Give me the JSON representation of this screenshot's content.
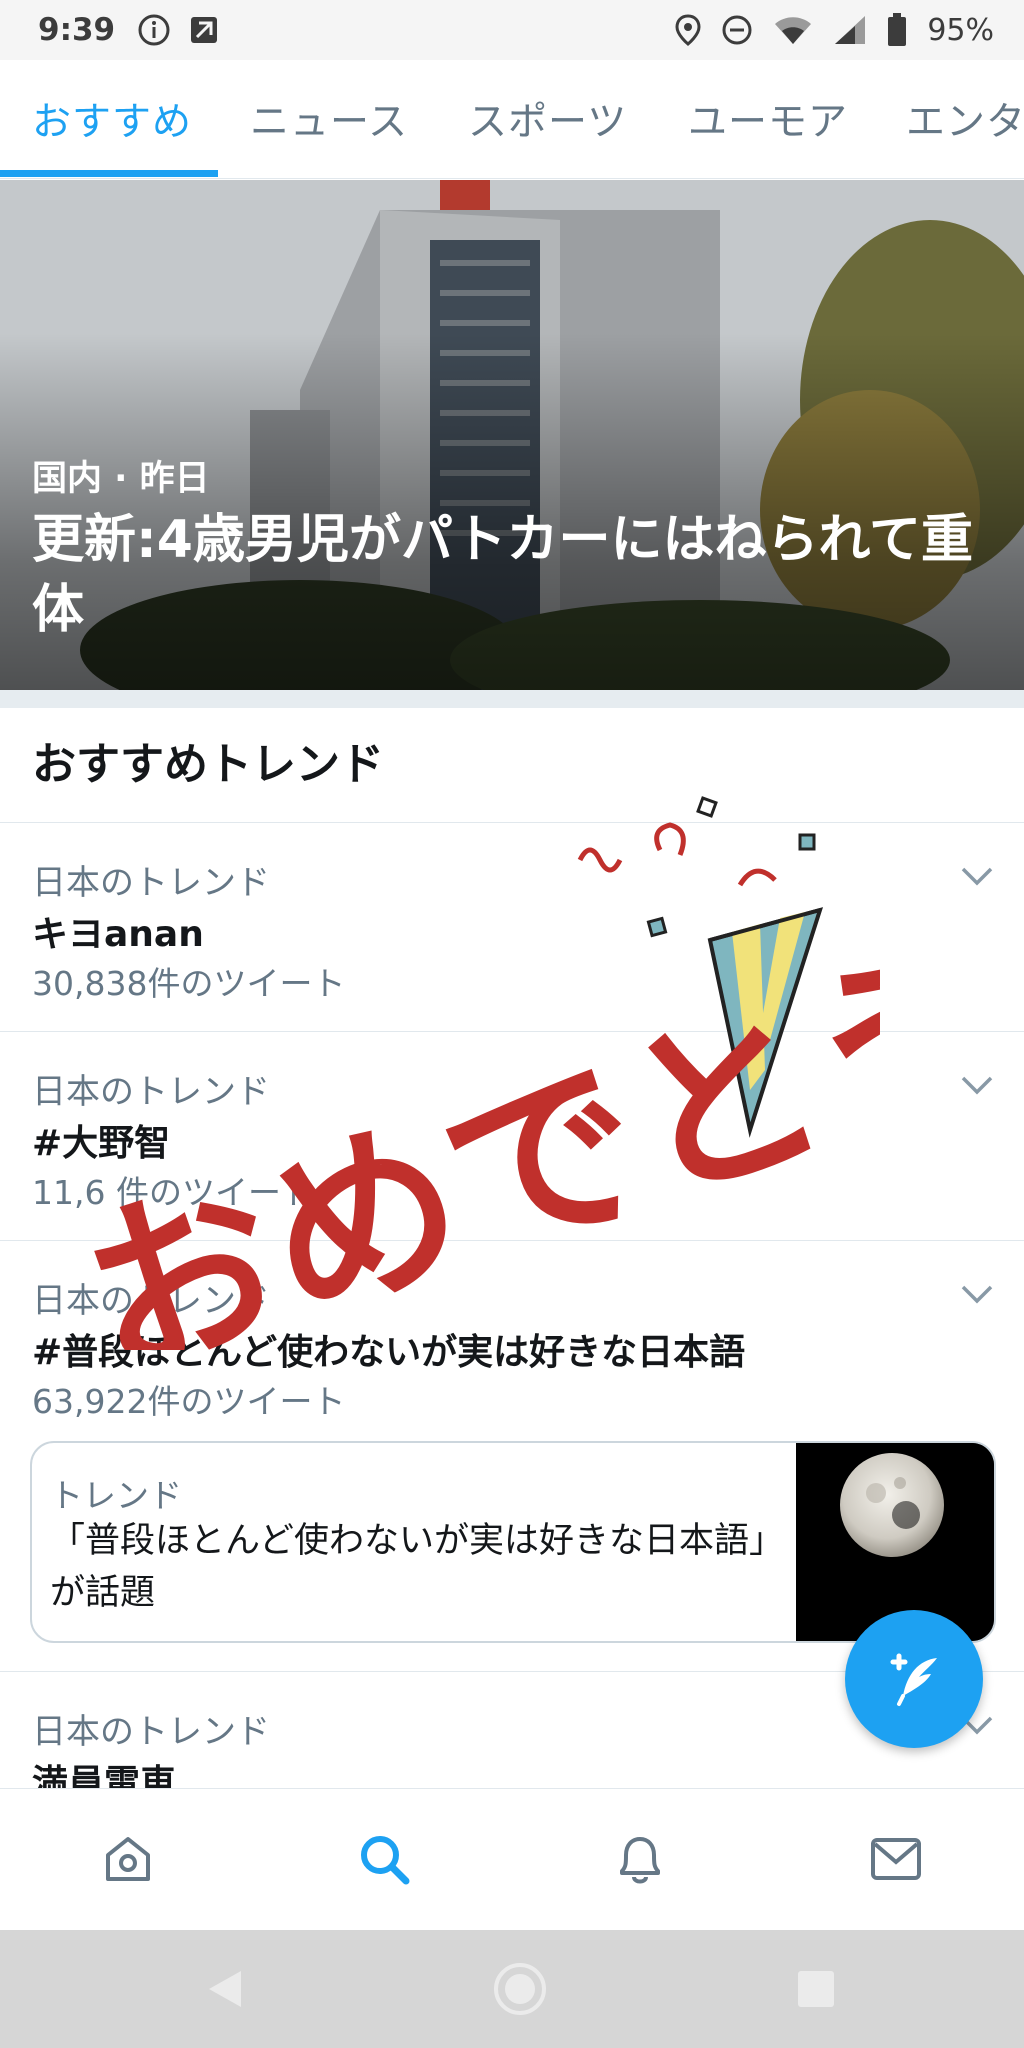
{
  "status_bar": {
    "time": "9:39",
    "battery": "95%",
    "icons": [
      "info-icon",
      "notification-icon",
      "location-icon",
      "do-not-disturb-icon",
      "wifi-icon",
      "signal-icon",
      "battery-icon"
    ]
  },
  "tabs": [
    {
      "label": "おすすめ",
      "active": true
    },
    {
      "label": "ニュース",
      "active": false
    },
    {
      "label": "スポーツ",
      "active": false
    },
    {
      "label": "ユーモア",
      "active": false
    },
    {
      "label": "エンタ",
      "active": false
    }
  ],
  "hero": {
    "meta": "国内 · 昨日",
    "title": "更新:4歳男児がパトカーにはねられて重体"
  },
  "section_title": "おすすめトレンド",
  "trends": [
    {
      "context": "日本のトレンド",
      "name": "キヨanan",
      "count": "30,838件のツイート"
    },
    {
      "context": "日本のトレンド",
      "name": "#大野智",
      "count": "11,6 件のツイート"
    },
    {
      "context": "日本のトレンド",
      "name": "#普段ほとんど使わないが実は好きな日本語",
      "count": "63,922件のツイート"
    },
    {
      "context": "日本のトレンド",
      "name": "満員電車",
      "count": ""
    }
  ],
  "trend_card": {
    "label": "トレンド",
    "text": "「普段ほとんど使わないが実は好きな日本語」が話題"
  },
  "sticker_text": "おめでとう",
  "bottom_nav": [
    "home-icon",
    "search-icon",
    "bell-icon",
    "mail-icon"
  ],
  "colors": {
    "accent": "#1da1f2",
    "secondary_text": "#657786",
    "primary_text": "#14171a",
    "sticker_red": "#c0302c"
  }
}
